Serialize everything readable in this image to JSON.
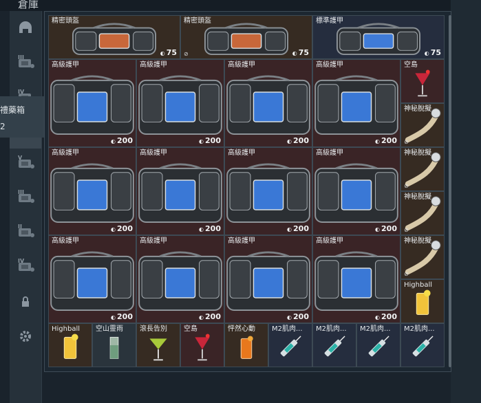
{
  "header": {
    "title": "倉庫"
  },
  "sidebar": {
    "tabs": [
      {
        "icon": "helmet-icon",
        "level": ""
      },
      {
        "icon": "armor-lvl3-icon",
        "level": "III"
      },
      {
        "icon": "backpack-lvl4-icon",
        "level": "IV"
      },
      {
        "icon": "add-backpack-icon",
        "level": ""
      },
      {
        "icon": "armor-lvl5-icon",
        "level": "V"
      },
      {
        "icon": "armor-lvl3b-icon",
        "level": "III"
      },
      {
        "icon": "weapon-lvl2-icon",
        "level": "II"
      },
      {
        "icon": "weapon-lvl4-icon",
        "level": "IV"
      },
      {
        "icon": "lock-icon",
        "level": ""
      },
      {
        "icon": "gear-icon",
        "level": ""
      }
    ]
  },
  "tooltip": {
    "line1": "禮藥箱",
    "line2": "2"
  },
  "inventory": {
    "top_row": [
      {
        "name": "精密頭盔",
        "durability": "75",
        "rarity": "brown",
        "locked": false
      },
      {
        "name": "精密頭盔",
        "durability": "75",
        "rarity": "brown",
        "locked": true
      },
      {
        "name": "標準護甲",
        "durability": "75",
        "rarity": "blue",
        "locked": false
      }
    ],
    "armor": [
      {
        "name": "高級護甲",
        "durability": "200"
      },
      {
        "name": "高級護甲",
        "durability": "200"
      },
      {
        "name": "高級護甲",
        "durability": "200"
      },
      {
        "name": "高級護甲",
        "durability": "200"
      },
      {
        "name": "高級護甲",
        "durability": "200"
      },
      {
        "name": "高級護甲",
        "durability": "200"
      },
      {
        "name": "高級護甲",
        "durability": "200"
      },
      {
        "name": "高級護甲",
        "durability": "200"
      },
      {
        "name": "高級護甲",
        "durability": "200"
      },
      {
        "name": "高級護甲",
        "durability": "200"
      },
      {
        "name": "高級護甲",
        "durability": "200"
      },
      {
        "name": "高級護甲",
        "durability": "200"
      }
    ],
    "side_column": [
      {
        "name": "空島",
        "type": "cocktail-red",
        "rarity": "red",
        "locked": false
      },
      {
        "name": "神秘脫擬",
        "type": "horn",
        "rarity": "brown",
        "locked": true
      },
      {
        "name": "神秘脫擬",
        "type": "horn",
        "rarity": "brown",
        "locked": true
      },
      {
        "name": "神秘脫擬",
        "type": "horn",
        "rarity": "brown",
        "locked": true
      },
      {
        "name": "神秘脫擬",
        "type": "horn",
        "rarity": "brown",
        "locked": true
      },
      {
        "name": "Highball",
        "type": "highball",
        "rarity": "brown",
        "locked": false
      }
    ],
    "bottom_row": [
      {
        "name": "Highball",
        "type": "highball",
        "rarity": "brown"
      },
      {
        "name": "空山靈雨",
        "type": "tall-glass",
        "rarity": "gray"
      },
      {
        "name": "滾長告別",
        "type": "martini",
        "rarity": "brown"
      },
      {
        "name": "空島",
        "type": "cocktail-red",
        "rarity": "red"
      },
      {
        "name": "怦然心動",
        "type": "orange-glass",
        "rarity": "brown"
      },
      {
        "name": "M2肌肉...",
        "type": "syringe",
        "rarity": "blue"
      },
      {
        "name": "M2肌肉...",
        "type": "syringe",
        "rarity": "blue"
      },
      {
        "name": "M2肌肉...",
        "type": "syringe",
        "rarity": "blue"
      },
      {
        "name": "M2肌肉...",
        "type": "syringe",
        "rarity": "blue"
      }
    ]
  },
  "colors": {
    "red": "#3a2426",
    "brown": "#362b22",
    "blue": "#252d3e",
    "gray": "#2a343c"
  }
}
